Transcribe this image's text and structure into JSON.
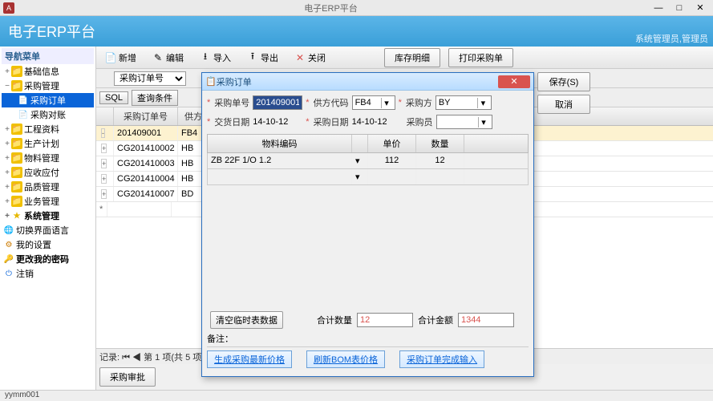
{
  "window": {
    "title": "电子ERP平台",
    "min": "—",
    "max": "□",
    "close": "✕"
  },
  "app": {
    "title": "电子ERP平台",
    "header_right": "系统管理员,管理员"
  },
  "sidebar": {
    "header": "导航菜单",
    "items": [
      {
        "label": "基础信息",
        "exp": "+"
      },
      {
        "label": "采购管理",
        "exp": "−",
        "children": [
          {
            "label": "采购订单",
            "selected": true
          },
          {
            "label": "采购对账"
          }
        ]
      },
      {
        "label": "工程资料",
        "exp": "+"
      },
      {
        "label": "生产计划",
        "exp": "+"
      },
      {
        "label": "物料管理",
        "exp": "+"
      },
      {
        "label": "应收应付",
        "exp": "+"
      },
      {
        "label": "品质管理",
        "exp": "+"
      },
      {
        "label": "业务管理",
        "exp": "+"
      },
      {
        "label": "系统管理",
        "exp": "+",
        "bold": true
      },
      {
        "label": "切换界面语言",
        "icon": "🌐"
      },
      {
        "label": "我的设置",
        "icon": "⚙"
      },
      {
        "label": "更改我的密码",
        "icon": "🔑",
        "bold": true
      },
      {
        "label": "注销",
        "icon": "⏻"
      }
    ]
  },
  "toolbar": {
    "new": "新增",
    "edit": "编辑",
    "import": "导入",
    "export": "导出",
    "close": "关闭",
    "btn1": "库存明细",
    "btn2": "打印采购单"
  },
  "filter": {
    "field": "采购订单号",
    "sql": "SQL",
    "query": "查询条件"
  },
  "grid": {
    "columns": [
      "采购订单号",
      "供方代"
    ],
    "rows": [
      {
        "no": "201409001",
        "sup": "FB4",
        "sel": true,
        "exp": "-"
      },
      {
        "no": "CG201410002",
        "sup": "HB",
        "exp": "+"
      },
      {
        "no": "CG201410003",
        "sup": "HB",
        "exp": "+"
      },
      {
        "no": "CG201410004",
        "sup": "HB",
        "exp": "+"
      },
      {
        "no": "CG201410007",
        "sup": "BD",
        "exp": "+"
      }
    ],
    "nav": "记录: ⏮ ◀  第 1 项(共 5 项)  ▶ ⏭"
  },
  "approve_btn": "采购审批",
  "dialog": {
    "title": "采购订单",
    "save": "保存(S)",
    "cancel": "取消",
    "f": {
      "order_no_lbl": "采购单号",
      "order_no": "201409001",
      "sup_code_lbl": "供方代码",
      "sup_code": "FB4",
      "buyer_side_lbl": "采购方",
      "buyer_side": "BY",
      "deliv_date_lbl": "交货日期",
      "deliv_date": "14-10-12",
      "order_date_lbl": "采购日期",
      "order_date": "14-10-12",
      "buyer_lbl": "采购员",
      "buyer": ""
    },
    "item_cols": [
      "物料编码",
      "",
      "单价",
      "数量"
    ],
    "item_row": {
      "code": "ZB 22F 1/O 1.2",
      "price": "112",
      "qty": "12"
    },
    "clear_btn": "清空临时表数据",
    "sum_qty_lbl": "合计数量",
    "sum_qty": "12",
    "sum_amt_lbl": "合计金额",
    "sum_amt": "1344",
    "note_lbl": "备注：",
    "link1": "生成采购最新价格",
    "link2": "刷新BOM表价格",
    "link3": "采购订单完成输入"
  },
  "status": "yymm001"
}
